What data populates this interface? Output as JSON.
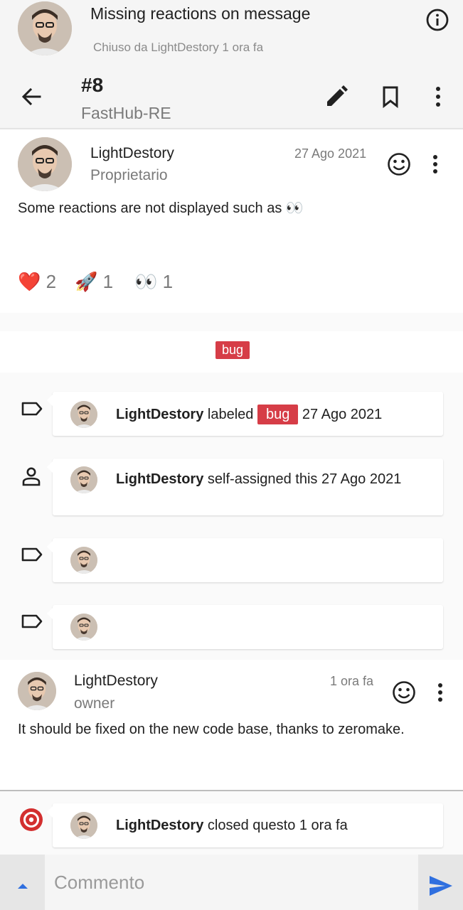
{
  "header": {
    "title": "Missing reactions on message",
    "status": "Chiuso da LightDestory 1 ora fa",
    "issue_number": "#8",
    "repo_name": "FastHub-RE"
  },
  "comment1": {
    "author": "LightDestory",
    "role": "Proprietario",
    "date": "27 Ago 2021",
    "body": "Some reactions are not displayed such as 👀",
    "reactions": [
      {
        "emoji": "❤️",
        "count": "2"
      },
      {
        "emoji": "🚀",
        "count": "1"
      },
      {
        "emoji": "👀",
        "count": "1"
      }
    ]
  },
  "label_strip": {
    "label": "bug"
  },
  "events": [
    {
      "author": "LightDestory",
      "action": "labeled",
      "badge": "bug",
      "date": "27 Ago 2021"
    },
    {
      "author": "LightDestory",
      "action": "self-assigned this 27 Ago 2021"
    },
    {
      "author": "",
      "action": ""
    },
    {
      "author": "",
      "action": ""
    }
  ],
  "comment2": {
    "author": "LightDestory",
    "role": "owner",
    "date": "1 ora fa",
    "body": "It should be fixed on the new code base, thanks to zeromake."
  },
  "closed_event": {
    "author": "LightDestory",
    "action": "closed questo 1 ora fa"
  },
  "composer": {
    "placeholder": "Commento"
  },
  "colors": {
    "label_red": "#d63d47",
    "send_blue": "#2f6fdf",
    "closed_red": "#d32f2f"
  }
}
